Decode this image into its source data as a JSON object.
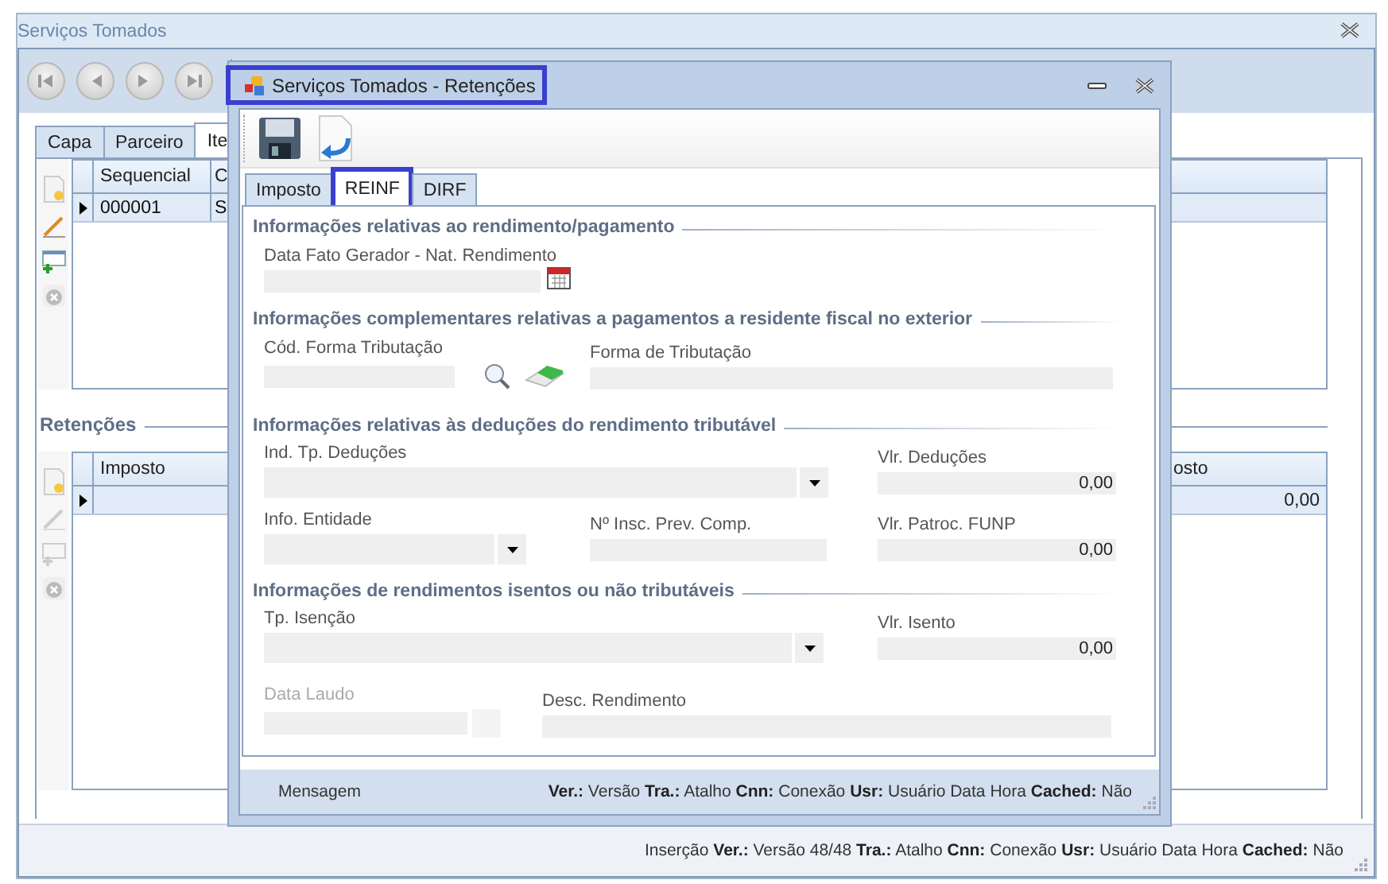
{
  "main_window": {
    "title": "Serviços Tomados",
    "tabs": [
      {
        "label": "Capa",
        "selected": false
      },
      {
        "label": "Parceiro",
        "selected": false
      },
      {
        "label": "Ite",
        "selected": true
      }
    ],
    "items_grid": {
      "columns": [
        "Sequencial",
        "C"
      ],
      "rows": [
        {
          "cells": [
            "000001",
            "S"
          ],
          "current": true
        }
      ]
    },
    "retencoes": {
      "title": "Retenções",
      "columns": [
        "Imposto",
        "osto"
      ],
      "rows": [
        {
          "cells": [
            "",
            "0,00"
          ],
          "current": true
        }
      ]
    },
    "status_bar": "Inserção **Ver.:** Versão 48/48 **Tra.:** Atalho **Cnn:** Conexão **Usr:** Usuário Data Hora **Cached:** Não"
  },
  "dialog": {
    "title": "Serviços Tomados - Retenções",
    "highlighted": true,
    "tabs": [
      {
        "label": "Imposto",
        "selected": false,
        "highlighted": false
      },
      {
        "label": "REINF",
        "selected": true,
        "highlighted": true
      },
      {
        "label": "DIRF",
        "selected": false,
        "highlighted": false
      }
    ],
    "sections": [
      {
        "title": "Informações relativas ao rendimento/pagamento",
        "rows": [
          {
            "fields": [
              {
                "kind": "date",
                "label": "Data Fato Gerador - Nat. Rendimento",
                "disabled": false
              }
            ]
          }
        ]
      },
      {
        "title": "Informações complementares relativas a pagamentos a residente fiscal no exterior",
        "rows": [
          {
            "fields": [
              {
                "kind": "lookup",
                "label": "Cód. Forma Tributação",
                "disabled": false
              },
              {
                "kind": "text",
                "label": "Forma de Tributação",
                "disabled": false
              }
            ]
          }
        ]
      },
      {
        "title": "Informações relativas às deduções do rendimento tributável",
        "rows": [
          {
            "fields": [
              {
                "kind": "combo",
                "label": "Ind. Tp. Deduções",
                "disabled": false
              },
              {
                "kind": "number",
                "label": "Vlr. Deduções",
                "value": "0,00",
                "disabled": false
              }
            ]
          },
          {
            "fields": [
              {
                "kind": "combo",
                "label": "Info. Entidade",
                "disabled": false
              },
              {
                "kind": "text",
                "label": "Nº Insc. Prev. Comp.",
                "disabled": false
              },
              {
                "kind": "number",
                "label": "Vlr. Patroc. FUNP",
                "value": "0,00",
                "disabled": false
              }
            ]
          }
        ]
      },
      {
        "title": "Informações de rendimentos isentos ou não tributáveis",
        "rows": [
          {
            "fields": [
              {
                "kind": "combo",
                "label": "Tp. Isenção",
                "disabled": false
              },
              {
                "kind": "number",
                "label": "Vlr. Isento",
                "value": "0,00",
                "disabled": false
              }
            ]
          },
          {
            "fields": [
              {
                "kind": "date",
                "label": "Data Laudo",
                "disabled": true
              },
              {
                "kind": "text",
                "label": "Desc. Rendimento",
                "disabled": false
              }
            ]
          }
        ]
      }
    ],
    "message": "Mensagem",
    "status_bar": "**Ver.:** Versão **Tra.:** Atalho **Cnn:** Conexão **Usr:** Usuário Data Hora **Cached:** Não"
  }
}
